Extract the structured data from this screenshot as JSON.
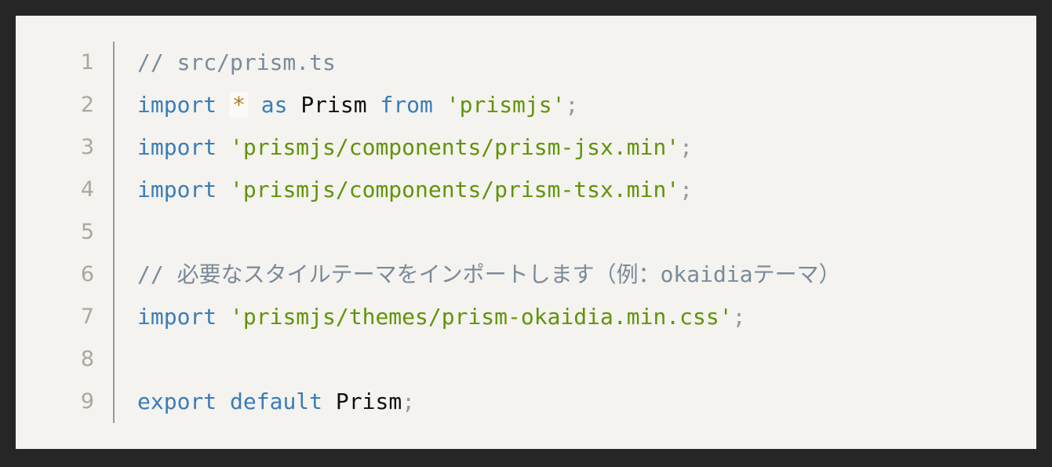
{
  "window": {
    "background_color": "#262626",
    "panel_background_color": "#f4f3ef"
  },
  "editor": {
    "language": "typescript",
    "gutter_separator_color": "#9a9a9a",
    "line_number_color": "#a8a8a3",
    "theme_colors": {
      "comment": "#7b8a99",
      "keyword": "#3a7cb8",
      "string": "#629309",
      "operator": "#b07d2b",
      "plain": "#111111",
      "punctuation": "#9a9a9a"
    },
    "lines": [
      {
        "number": "1",
        "tokens": [
          {
            "text": "// src/prism.ts",
            "type": "comment"
          }
        ]
      },
      {
        "number": "2",
        "tokens": [
          {
            "text": "import",
            "type": "keyword"
          },
          {
            "text": " ",
            "type": "plain"
          },
          {
            "text": "*",
            "type": "operator"
          },
          {
            "text": " ",
            "type": "plain"
          },
          {
            "text": "as",
            "type": "keyword"
          },
          {
            "text": " ",
            "type": "plain"
          },
          {
            "text": "Prism",
            "type": "plain"
          },
          {
            "text": " ",
            "type": "plain"
          },
          {
            "text": "from",
            "type": "keyword"
          },
          {
            "text": " ",
            "type": "plain"
          },
          {
            "text": "'prismjs'",
            "type": "string"
          },
          {
            "text": ";",
            "type": "punctuation"
          }
        ]
      },
      {
        "number": "3",
        "tokens": [
          {
            "text": "import",
            "type": "keyword"
          },
          {
            "text": " ",
            "type": "plain"
          },
          {
            "text": "'prismjs/components/prism-jsx.min'",
            "type": "string"
          },
          {
            "text": ";",
            "type": "punctuation"
          }
        ]
      },
      {
        "number": "4",
        "tokens": [
          {
            "text": "import",
            "type": "keyword"
          },
          {
            "text": " ",
            "type": "plain"
          },
          {
            "text": "'prismjs/components/prism-tsx.min'",
            "type": "string"
          },
          {
            "text": ";",
            "type": "punctuation"
          }
        ]
      },
      {
        "number": "5",
        "tokens": []
      },
      {
        "number": "6",
        "tokens": [
          {
            "text": "// 必要なスタイルテーマをインポートします（例：okaidiaテーマ）",
            "type": "comment"
          }
        ]
      },
      {
        "number": "7",
        "tokens": [
          {
            "text": "import",
            "type": "keyword"
          },
          {
            "text": " ",
            "type": "plain"
          },
          {
            "text": "'prismjs/themes/prism-okaidia.min.css'",
            "type": "string"
          },
          {
            "text": ";",
            "type": "punctuation"
          }
        ]
      },
      {
        "number": "8",
        "tokens": []
      },
      {
        "number": "9",
        "tokens": [
          {
            "text": "export",
            "type": "keyword"
          },
          {
            "text": " ",
            "type": "plain"
          },
          {
            "text": "default",
            "type": "keyword"
          },
          {
            "text": " ",
            "type": "plain"
          },
          {
            "text": "Prism",
            "type": "plain"
          },
          {
            "text": ";",
            "type": "punctuation"
          }
        ]
      }
    ]
  }
}
